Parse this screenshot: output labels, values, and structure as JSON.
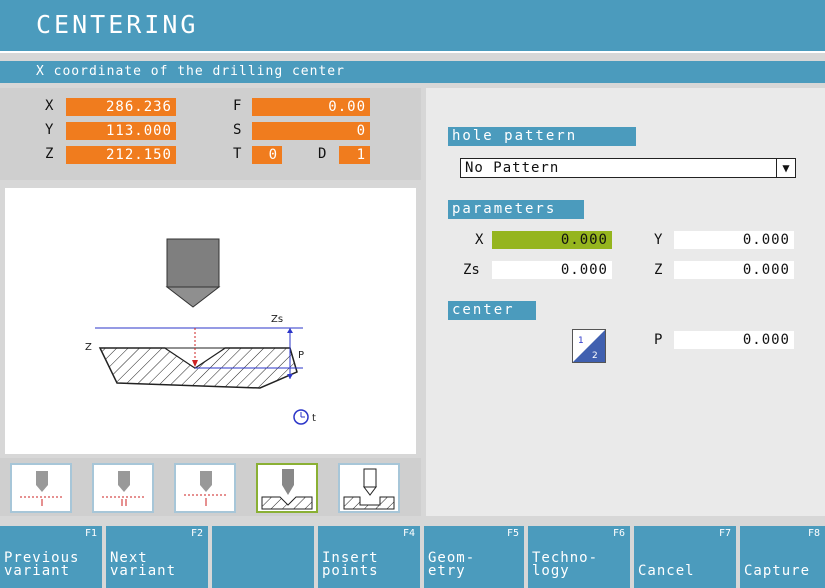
{
  "title": "CENTERING",
  "status": "X coordinate of the drilling center",
  "coords": {
    "x_label": "X",
    "x_value": "286.236",
    "y_label": "Y",
    "y_value": "113.000",
    "z_label": "Z",
    "z_value": "212.150",
    "f_label": "F",
    "f_value": "0.00",
    "s_label": "S",
    "s_value": "0",
    "t_label": "T",
    "t_value": "0",
    "d_label": "D",
    "d_value": "1"
  },
  "drawing": {
    "zs_label": "Zs",
    "z_label": "Z",
    "p_label": "P",
    "t_label": "t"
  },
  "hole_pattern": {
    "header": "hole pattern",
    "selected": "No Pattern"
  },
  "parameters": {
    "header": "parameters",
    "x_label": "X",
    "x_value": "0.000",
    "y_label": "Y",
    "y_value": "0.000",
    "zs_label": "Zs",
    "zs_value": "0.000",
    "z_label": "Z",
    "z_value": "0.000"
  },
  "center": {
    "header": "center",
    "p_label": "P",
    "p_value": "0.000",
    "icon_top": "1",
    "icon_bottom": "2"
  },
  "softkeys": [
    {
      "fn": "F1",
      "label": "Previous\nvariant"
    },
    {
      "fn": "F2",
      "label": "Next\nvariant"
    },
    {
      "fn": "",
      "label": ""
    },
    {
      "fn": "F4",
      "label": "Insert\npoints"
    },
    {
      "fn": "F5",
      "label": "Geom-\netry"
    },
    {
      "fn": "F6",
      "label": "Techno-\nlogy"
    },
    {
      "fn": "F7",
      "label": "Cancel"
    },
    {
      "fn": "F8",
      "label": "Capture"
    }
  ],
  "colors": {
    "accent": "#4b9bbd",
    "orange": "#f07c1e",
    "green": "#95b51e"
  }
}
